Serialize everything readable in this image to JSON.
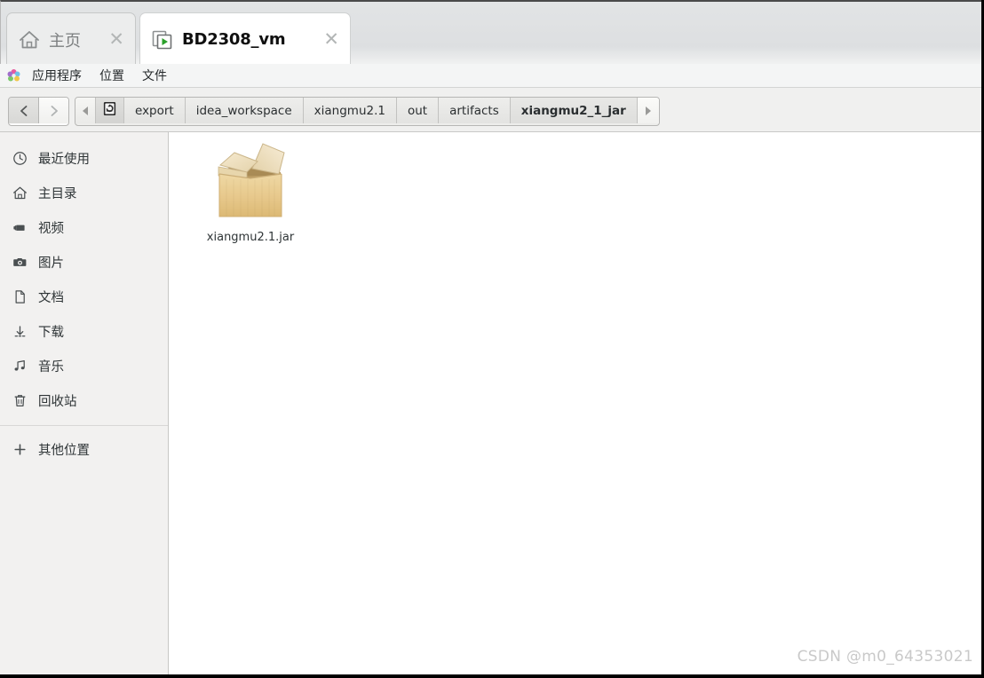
{
  "window": {
    "accent_black": "#000000",
    "sidebar_bg": "#f2f1f0",
    "content_bg": "#ffffff"
  },
  "tabs": [
    {
      "id": "home",
      "label": "主页",
      "icon": "home-icon",
      "close_glyph": "✕",
      "active": false
    },
    {
      "id": "vm",
      "label": "BD2308_vm",
      "icon": "vm-play-icon",
      "close_glyph": "✕",
      "active": true
    }
  ],
  "menu": {
    "icon": "gnome-applications-icon",
    "items": [
      {
        "label": "应用程序"
      },
      {
        "label": "位置"
      },
      {
        "label": "文件"
      }
    ]
  },
  "toolbar": {
    "back_label": "‹",
    "back_icon": "chevron-left-icon",
    "forward_label": "›",
    "forward_icon": "chevron-right-icon",
    "scroll_left_icon": "triangle-left-icon",
    "scroll_right_icon": "triangle-right-icon",
    "device_icon": "filesystem-device-icon"
  },
  "breadcrumb": {
    "segments": [
      {
        "label": "export",
        "active": false
      },
      {
        "label": "idea_workspace",
        "active": false
      },
      {
        "label": "xiangmu2.1",
        "active": false
      },
      {
        "label": "out",
        "active": false
      },
      {
        "label": "artifacts",
        "active": false
      },
      {
        "label": "xiangmu2_1_jar",
        "active": true
      }
    ]
  },
  "sidebar": {
    "items": [
      {
        "label": "最近使用",
        "icon": "clock-icon"
      },
      {
        "label": "主目录",
        "icon": "home-icon"
      },
      {
        "label": "视频",
        "icon": "video-camera-icon"
      },
      {
        "label": "图片",
        "icon": "camera-icon"
      },
      {
        "label": "文档",
        "icon": "document-icon"
      },
      {
        "label": "下载",
        "icon": "download-arrow-icon"
      },
      {
        "label": "音乐",
        "icon": "music-note-icon"
      },
      {
        "label": "回收站",
        "icon": "trash-icon"
      }
    ],
    "other_locations": {
      "label": "其他位置",
      "icon": "plus-icon"
    }
  },
  "files": [
    {
      "name": "xiangmu2.1.jar",
      "icon": "package-box-icon"
    }
  ],
  "watermark": {
    "text": "CSDN @m0_64353021"
  }
}
